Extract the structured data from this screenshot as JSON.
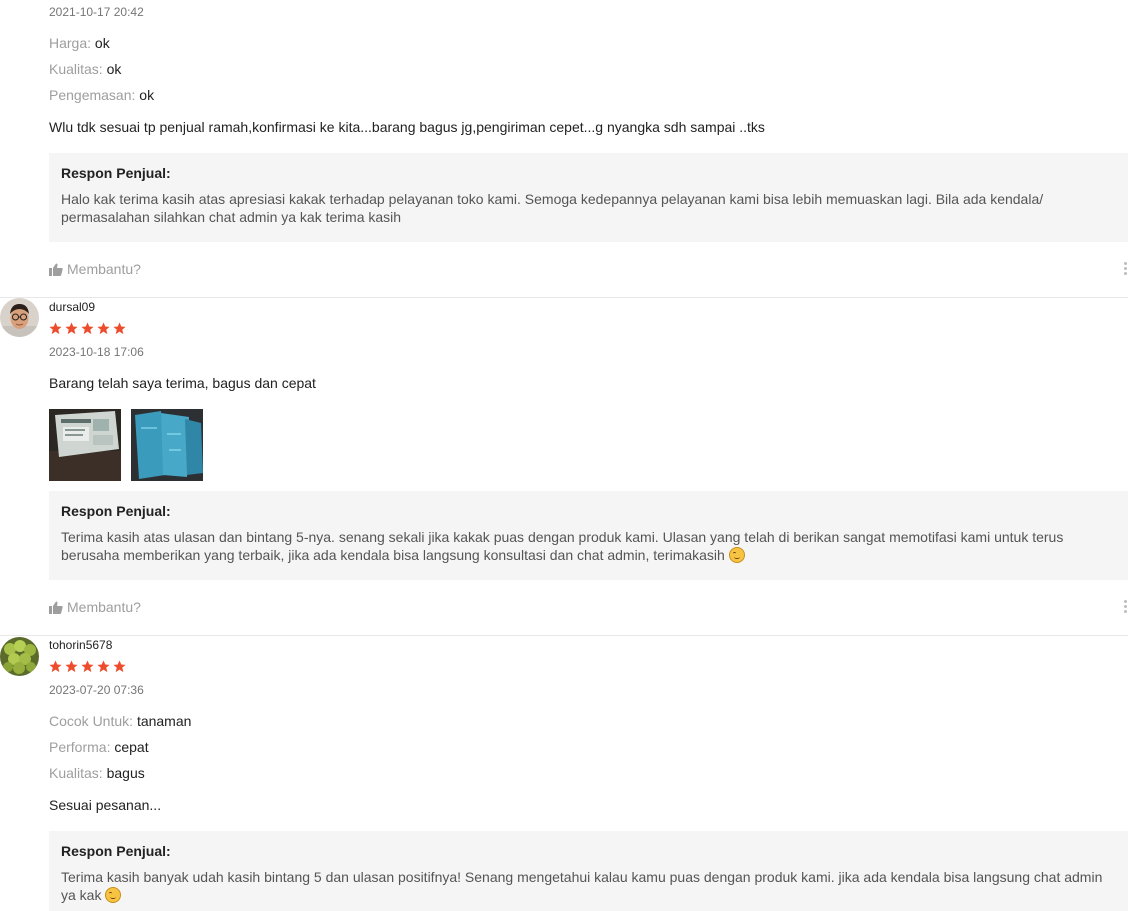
{
  "reviews": [
    {
      "date": "2021-10-17 20:42",
      "attributes": [
        {
          "key": "Harga:",
          "value": "ok"
        },
        {
          "key": "Kualitas:",
          "value": "ok"
        },
        {
          "key": "Pengemasan:",
          "value": "ok"
        }
      ],
      "comment": "Wlu tdk sesuai tp penjual ramah,konfirmasi ke kita...barang bagus jg,pengiriman cepet...g nyangka sdh sampai ..tks",
      "response_title": "Respon Penjual:",
      "response_text": "Halo kak terima kasih atas apresiasi kakak terhadap pelayanan toko kami. Semoga kedepannya pelayanan kami bisa lebih memuaskan lagi. Bila ada kendala/ permasalahan silahkan chat admin ya kak terima kasih",
      "helpful_label": "Membantu?"
    },
    {
      "username": "dursal09",
      "rating": 5,
      "date": "2023-10-18 17:06",
      "comment": "Barang telah saya terima, bagus dan cepat",
      "response_title": "Respon Penjual:",
      "response_text": "Terima kasih atas ulasan dan bintang 5-nya. senang sekali jika kakak puas dengan produk kami. Ulasan yang telah di berikan sangat memotifasi kami untuk terus berusaha memberikan yang terbaik, jika ada kendala bisa langsung konsultasi dan chat admin, terimakasih",
      "helpful_label": "Membantu?"
    },
    {
      "username": "tohorin5678",
      "rating": 5,
      "date": "2023-07-20 07:36",
      "attributes": [
        {
          "key": "Cocok Untuk:",
          "value": "tanaman"
        },
        {
          "key": "Performa:",
          "value": "cepat"
        },
        {
          "key": "Kualitas:",
          "value": "bagus"
        }
      ],
      "comment": "Sesuai pesanan...",
      "response_title": "Respon Penjual:",
      "response_text": "Terima kasih banyak udah kasih bintang 5 dan ulasan positifnya! Senang mengetahui kalau kamu puas dengan produk kami. jika ada kendala bisa langsung chat admin ya kak"
    }
  ],
  "colors": {
    "star": "#ee4d2d",
    "response_bg": "#f5f5f5",
    "muted": "#9e9e9e"
  }
}
